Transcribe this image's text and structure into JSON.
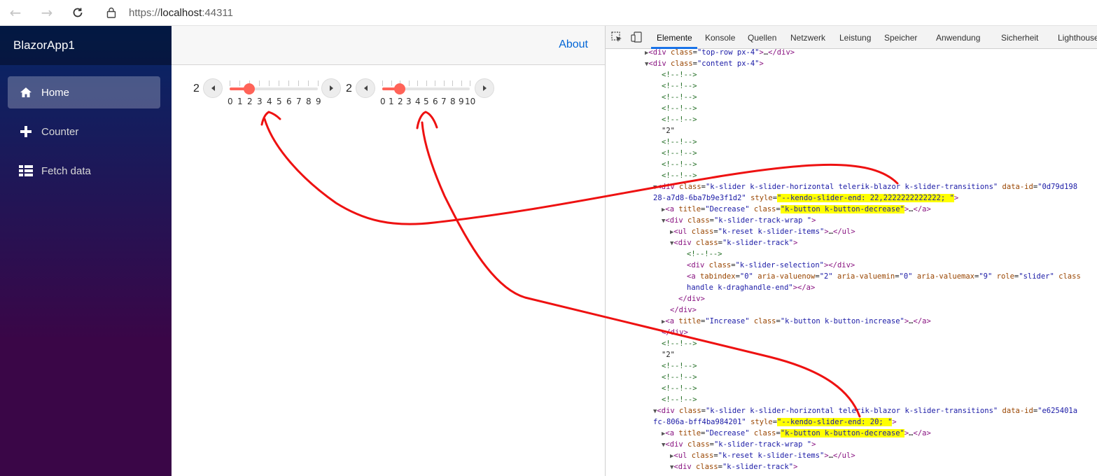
{
  "browser": {
    "back_icon": "arrow-left-icon",
    "forward_icon": "arrow-right-icon",
    "reload_icon": "reload-icon",
    "lock_icon": "lock-icon",
    "url_prefix": "https://",
    "url_host": "localhost",
    "url_port": ":44311"
  },
  "sidebar": {
    "brand": "BlazorApp1",
    "items": [
      {
        "label": "Home",
        "icon": "home-icon",
        "active": true
      },
      {
        "label": "Counter",
        "icon": "plus-icon",
        "active": false
      },
      {
        "label": "Fetch data",
        "icon": "list-icon",
        "active": false
      }
    ]
  },
  "main": {
    "about_link": "About",
    "sliders": [
      {
        "value_label": "2",
        "value": 2,
        "min": 0,
        "max": 9,
        "ticks": [
          "0",
          "1",
          "2",
          "3",
          "4",
          "5",
          "6",
          "7",
          "8",
          "9"
        ],
        "selection_color": "#ff6358"
      },
      {
        "value_label": "2",
        "value": 2,
        "min": 0,
        "max": 10,
        "ticks": [
          "0",
          "1",
          "2",
          "3",
          "4",
          "5",
          "6",
          "7",
          "8",
          "9",
          "10"
        ],
        "selection_color": "#ff6358"
      }
    ]
  },
  "devtools": {
    "inspect_icon": "inspect-element-icon",
    "device_icon": "device-toolbar-icon",
    "tabs": [
      "Elemente",
      "Konsole",
      "Quellen",
      "Netzwerk",
      "Leistung",
      "Speicher",
      "Anwendung",
      "Sicherheit",
      "Lighthouse"
    ],
    "active_tab": "Elemente",
    "highlight_color": "#ffff00",
    "annotation_color": "#ee0000"
  }
}
